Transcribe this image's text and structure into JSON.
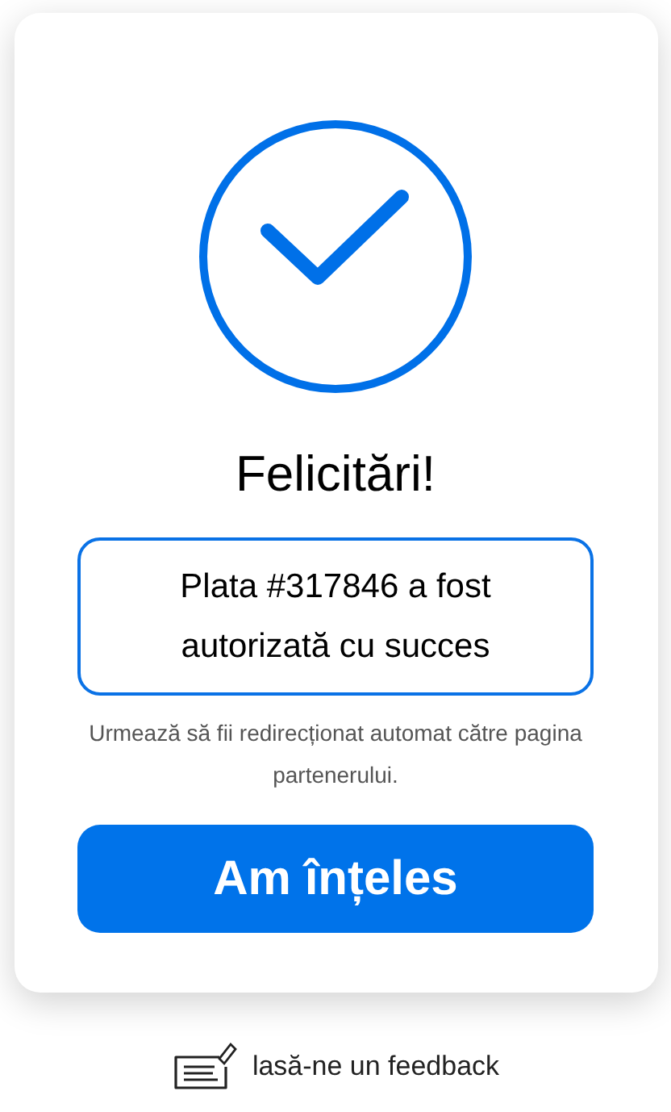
{
  "title": "Felicitări!",
  "message": "Plata #317846 a fost autorizată cu succes",
  "note": "Urmează să fii redirecționat automat către pagina partenerului.",
  "button": "Am înțeles",
  "feedback_link": "lasă-ne un feedback"
}
